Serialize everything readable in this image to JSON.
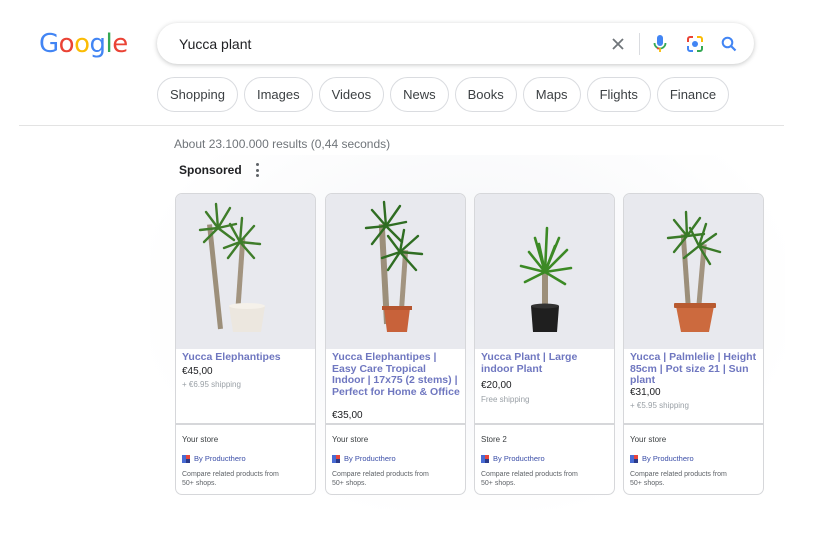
{
  "logo": {
    "letters": [
      {
        "ch": "G",
        "color": "#4285F4"
      },
      {
        "ch": "o",
        "color": "#EA4335"
      },
      {
        "ch": "o",
        "color": "#FBBC05"
      },
      {
        "ch": "g",
        "color": "#4285F4"
      },
      {
        "ch": "l",
        "color": "#34A853"
      },
      {
        "ch": "e",
        "color": "#EA4335"
      }
    ]
  },
  "search": {
    "value": "Yucca plant",
    "icons": [
      "close-icon",
      "mic-icon",
      "lens-icon",
      "search-icon"
    ]
  },
  "chips": [
    "Shopping",
    "Images",
    "Videos",
    "News",
    "Books",
    "Maps",
    "Flights",
    "Finance"
  ],
  "result_stats": "About 23.100.000 results (0,44 seconds)",
  "sponsored_label": "Sponsored",
  "cards": [
    {
      "title": "Yucca Elephantipes",
      "price": "€45,00",
      "shipping": "+ €6.95 shipping",
      "store": "Your store",
      "by": "By Producthero",
      "compare": "Compare related products from 50+ shops.",
      "pot_color": "#ece7df"
    },
    {
      "title": "Yucca Elephantipes | Easy Care Tropical Indoor | 17x75 (2 stems) | Perfect for Home & Office",
      "price": "€35,00",
      "shipping": "",
      "store": "Your store",
      "by": "By Producthero",
      "compare": "Compare related products from 50+ shops.",
      "pot_color": "#c8623a"
    },
    {
      "title": "Yucca Plant | Large indoor Plant",
      "price": "€20,00",
      "shipping": "Free shipping",
      "store": "Store 2",
      "by": "By Producthero",
      "compare": "Compare related products from 50+ shops.",
      "pot_color": "#1f1f1f"
    },
    {
      "title": "Yucca | Palmlelie | Height 85cm | Pot size 21 | Sun plant",
      "price": "€31,00",
      "shipping": "+ €5.95 shipping",
      "store": "Your store",
      "by": "By Producthero",
      "compare": "Compare related products from 50+ shops.",
      "pot_color": "#cc6a3e"
    }
  ]
}
